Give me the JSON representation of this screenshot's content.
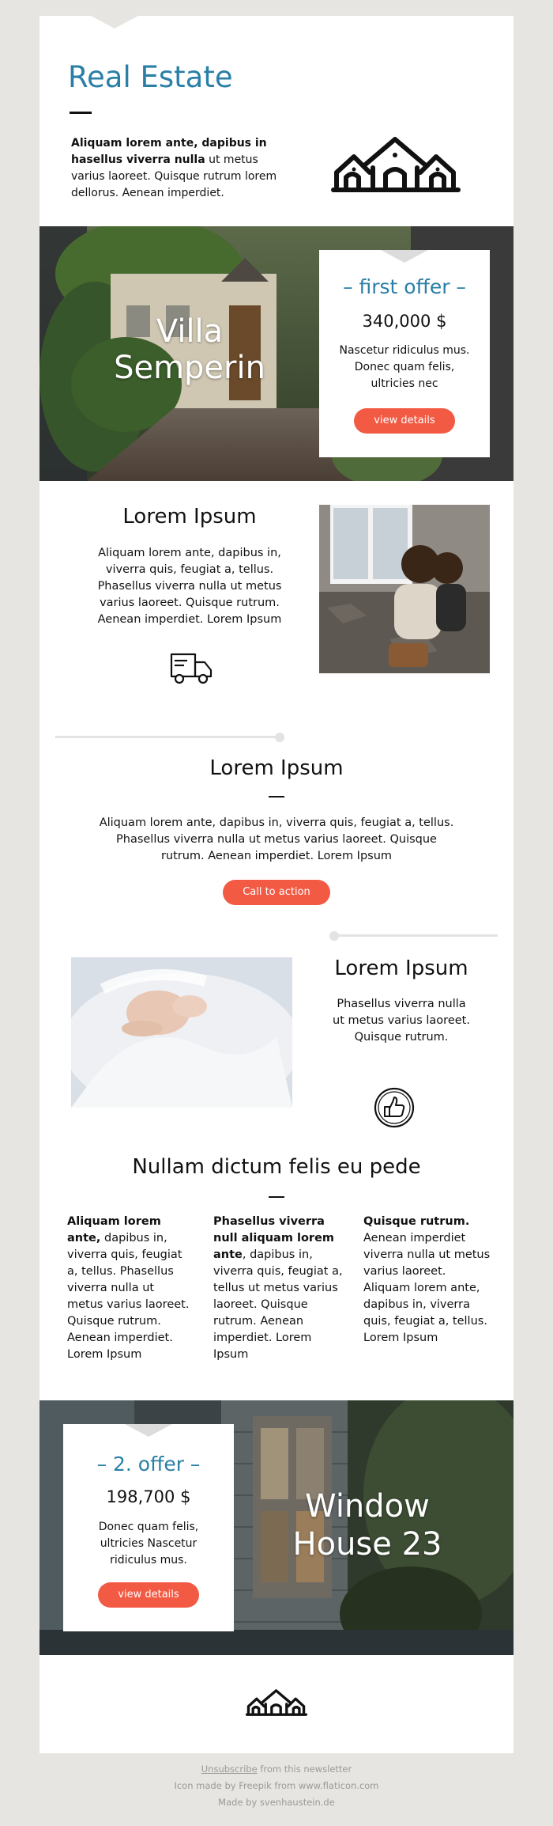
{
  "header": {
    "title": "Real Estate",
    "intro_bold": "Aliquam lorem ante, dapibus in hasellus viverra nulla",
    "intro_rest": " ut metus varius laoreet. Quisque rutrum lorem dellorus. Aenean imperdiet."
  },
  "offer1": {
    "image_caption_line1": "Villa",
    "image_caption_line2": "Semperin",
    "label": "– first offer –",
    "price": "340,000 $",
    "description": "Nascetur ridiculus mus. Donec quam felis, ultricies nec",
    "button": "view details"
  },
  "section1": {
    "heading": "Lorem Ipsum",
    "text": "Aliquam lorem ante, dapibus in, viverra quis, feugiat a, tellus. Phasellus viverra nulla ut metus varius laoreet. Quisque rutrum. Aenean imperdiet. Lorem Ipsum"
  },
  "section2": {
    "heading": "Lorem Ipsum",
    "text": "Aliquam lorem ante, dapibus in, viverra quis, feugiat a, tellus. Phasellus viverra nulla ut metus varius laoreet. Quisque rutrum. Aenean imperdiet. Lorem Ipsum",
    "button": "Call to action"
  },
  "section3": {
    "heading": "Lorem Ipsum",
    "text": "Phasellus viverra nulla ut metus varius laoreet. Quisque rutrum."
  },
  "columns": {
    "heading": "Nullam dictum felis eu pede",
    "col1_bold": "Aliquam lorem ante,",
    "col1_rest": " dapibus in, viverra quis, feugiat a, tellus. Phasellus viverra nulla ut metus varius laoreet. Quisque rutrum. Aenean imperdiet. Lorem Ipsum",
    "col2_bold": "Phasellus viverra null aliquam lorem ante",
    "col2_rest": ", dapibus in, viverra quis, feugiat a, tellus ut metus varius laoreet. Quisque rutrum. Aenean imperdiet. Lorem Ipsum",
    "col3_bold": "Quisque rutrum.",
    "col3_rest": " Aenean imperdiet viverra nulla ut metus varius laoreet. Aliquam lorem ante, dapibus in, viverra quis, feugiat a, tellus. Lorem Ipsum"
  },
  "offer2": {
    "label": "– 2. offer –",
    "price": "198,700 $",
    "description": "Donec quam felis, ultricies Nascetur ridiculus mus.",
    "button": "view details",
    "image_caption_line1": "Window",
    "image_caption_line2": "House 23"
  },
  "footer": {
    "unsubscribe": "Unsubscribe",
    "unsubscribe_rest": " from this newsletter",
    "credit": "Icon made by Freepik from www.flaticon.com",
    "made_by": "Made by svenhaustein.de"
  },
  "colors": {
    "accent": "#f25a44",
    "title_blue": "#2a7fa6",
    "background": "#e6e5e1"
  },
  "icons": [
    "houses-logo-icon",
    "delivery-truck-icon",
    "thumbs-up-icon"
  ]
}
